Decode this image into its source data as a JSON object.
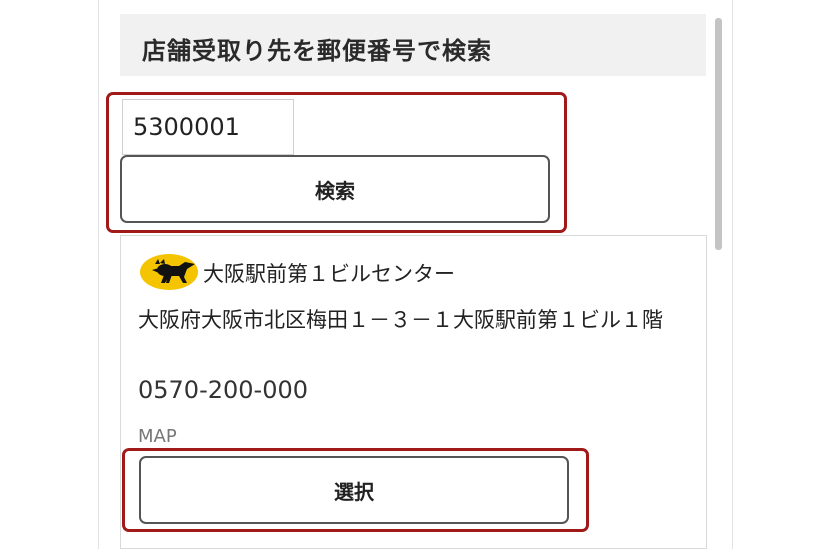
{
  "header": {
    "title": "店舗受取り先を郵便番号で検索"
  },
  "search": {
    "postal_code": "5300001",
    "button_label": "検索"
  },
  "store": {
    "logo_icon": "yamato-cat-logo-icon",
    "name": "大阪駅前第１ビルセンター",
    "address": "大阪府大阪市北区梅田１－３－１大阪駅前第１ビル１階",
    "phone": "0570-200-000",
    "map_label": "MAP",
    "select_label": "選択"
  },
  "colors": {
    "highlight": "#a11a1a",
    "header_bg": "#f1f1f1",
    "logo_yellow": "#f5c400"
  }
}
